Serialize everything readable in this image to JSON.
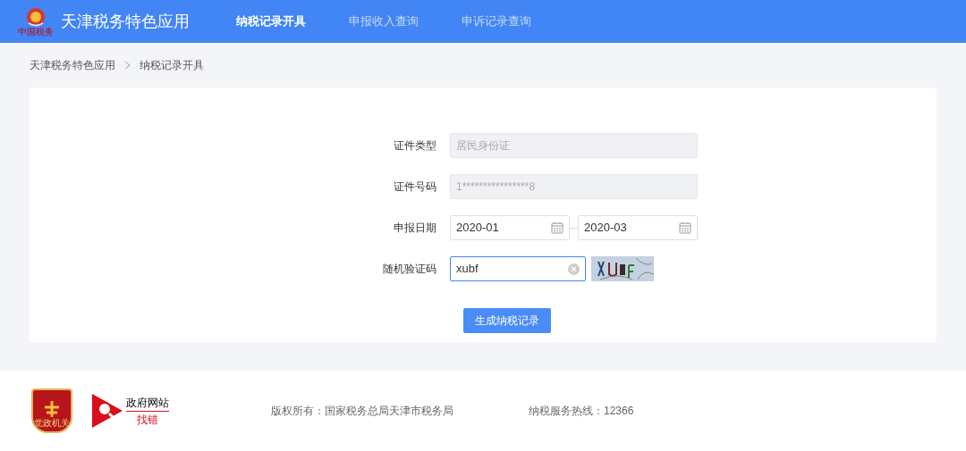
{
  "header": {
    "logo_caption": "中国税务",
    "title": "天津税务特色应用",
    "nav": [
      {
        "label": "纳税记录开具",
        "selected": true
      },
      {
        "label": "申报收入查询",
        "selected": false
      },
      {
        "label": "申诉记录查询",
        "selected": false
      }
    ]
  },
  "breadcrumb": [
    "天津税务特色应用",
    "纳税记录开具"
  ],
  "form": {
    "id_type": {
      "label": "证件类型",
      "value": "居民身份证",
      "disabled": true
    },
    "id_number": {
      "label": "证件号码",
      "value": "1****************8",
      "disabled": true
    },
    "date": {
      "label": "申报日期",
      "start": "2020-01",
      "end": "2020-03"
    },
    "captcha": {
      "label": "随机验证码",
      "value": "xubf"
    },
    "submit": "生成纳税记录"
  },
  "footer": {
    "badge": "党政机关",
    "gov_site": "政府网站",
    "gov_find": "找错",
    "copyright": "版权所有：国家税务总局天津市税务局",
    "hotline": "纳税服务热线：12366"
  }
}
